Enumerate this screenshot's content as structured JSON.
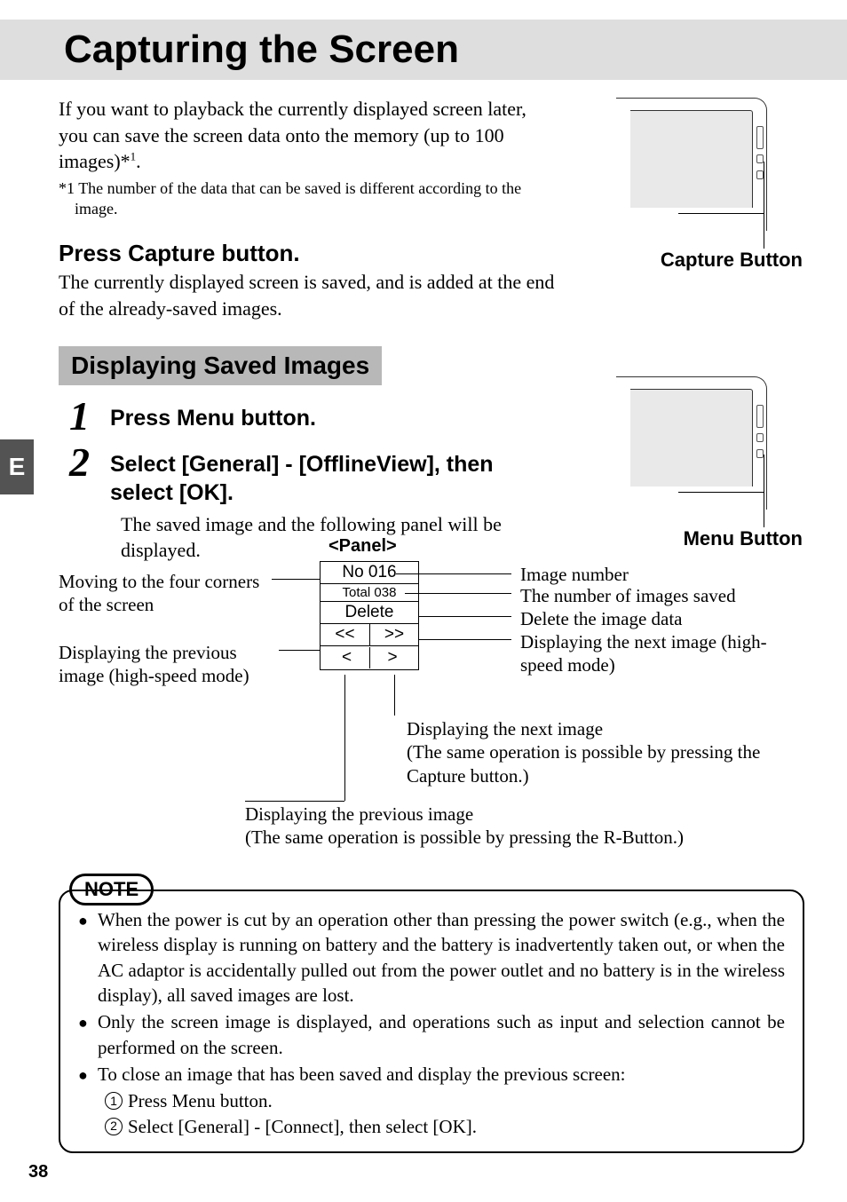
{
  "sideTab": "E",
  "title": "Capturing the Screen",
  "introPre": "If you want to playback the currently displayed screen later, you can save the screen data onto the memory (up to 100 images)*",
  "introSup": "1",
  "introPost": ".",
  "footnoteMarker": "*1 ",
  "footnote": "The number of the data that can be saved is different according to the image.",
  "pressCaptureHeading": "Press Capture button.",
  "pressCaptureBody": "The currently displayed screen is saved, and is added at the end of the already-saved images.",
  "captureButtonLabel": "Capture Button",
  "displayingHeading": "Displaying Saved Images",
  "step1num": "1",
  "step1": "Press Menu button.",
  "step2num": "2",
  "step2": "Select [General] - [OfflineView], then select [OK].",
  "step2desc": "The saved image and the following panel will be displayed.",
  "menuButtonLabel": "Menu Button",
  "panelTitle": "<Panel>",
  "panel": {
    "no": "No 016",
    "total": "Total 038",
    "delete": "Delete",
    "fastPrev": "<<",
    "fastNext": ">>",
    "prev": "<",
    "next": ">"
  },
  "ann": {
    "moveCorners": "Moving to the four corners of the screen",
    "prevHigh": "Displaying the previous image (high-speed mode)",
    "imageNumber": "Image number",
    "totalSaved": "The number of images saved",
    "deleteData": "Delete the image data",
    "nextHigh": "Displaying the next image (high-speed mode)",
    "nextImage": "Displaying the next image",
    "nextImageExtra": "(The same operation is possible by pressing the Capture button.)",
    "prevImage": "Displaying the previous image",
    "prevImageExtra": " (The same operation is possible by pressing the R-Button.)"
  },
  "note": {
    "tag": "NOTE",
    "b1": "When the power is cut by an operation other than pressing the power switch (e.g., when the wireless display is running on battery and the battery is inadvertently taken out, or when the AC adaptor is accidentally pulled out from the power outlet and no battery is in the wireless display), all saved images are lost.",
    "b2": "Only the screen image is displayed, and operations such as input and selection cannot be performed on the screen.",
    "b3": "To close an image that has been saved and display the previous screen:",
    "s1": "Press Menu button.",
    "s2": "Select [General] - [Connect], then select [OK]."
  },
  "pageNumber": "38"
}
